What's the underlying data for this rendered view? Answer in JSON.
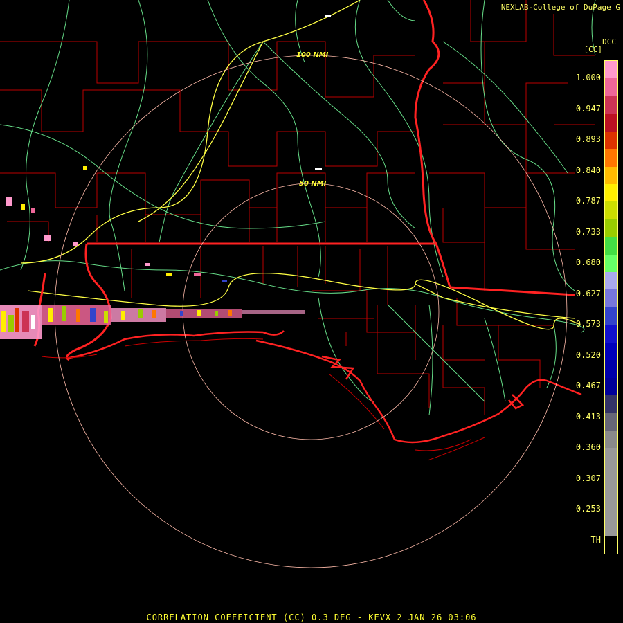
{
  "header": {
    "credit": "NEXLAB-College of DuPage G",
    "site": "DCC",
    "unit": "[CC]"
  },
  "footer": {
    "product": "CORRELATION COEFFICIENT (CC) 0.3 DEG - KEVX 2 JAN 26 03:06"
  },
  "rings": {
    "inner_label": "50 NMI",
    "outer_label": "100 NMI"
  },
  "legend": {
    "ticks": [
      "1.000",
      "0.947",
      "0.893",
      "0.840",
      "0.787",
      "0.733",
      "0.680",
      "0.627",
      "0.573",
      "0.520",
      "0.467",
      "0.413",
      "0.360",
      "0.307",
      "0.253",
      "TH"
    ],
    "colors": [
      "#ff99cc",
      "#ee6699",
      "#cc3355",
      "#bb1122",
      "#dd3300",
      "#ff7700",
      "#ffbb00",
      "#ffee00",
      "#ccdd00",
      "#99cc00",
      "#44dd44",
      "#66ff66",
      "#aaaaee",
      "#7777dd",
      "#3344cc",
      "#1111cc",
      "#0000bb",
      "#0000aa",
      "#000099",
      "#333366",
      "#666677",
      "#8a8a8a",
      "#999999",
      "#999999",
      "#999999",
      "#999999",
      "#999999",
      "#000000"
    ]
  },
  "colors": {
    "state_border": "#ff2222",
    "county_border": "#cc0000",
    "highway_major": "#ffff44",
    "highway_minor": "#66dd88",
    "range_ring": "#ffbbaa",
    "text": "#ffff33"
  }
}
